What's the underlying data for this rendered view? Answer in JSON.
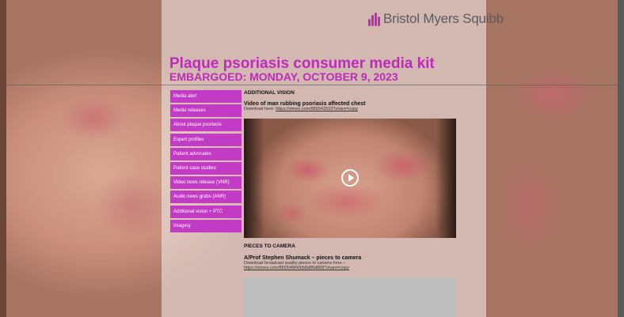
{
  "brand": {
    "name": "Bristol Myers Squibb",
    "accent_color": "#be2bbb",
    "logo_icon": "bms-brand-mark"
  },
  "header": {
    "title": "Plaque psoriasis consumer media kit",
    "subtitle": "EMBARGOED: MONDAY, OCTOBER 9, 2023"
  },
  "sidebar": {
    "items": [
      {
        "label": "Media alert"
      },
      {
        "label": "Media releases"
      },
      {
        "label": "About plaque psoriasis"
      },
      {
        "label": "Expert profiles"
      },
      {
        "label": "Patient advocates"
      },
      {
        "label": "Patient case studies"
      },
      {
        "label": "Video news release (VNR)"
      },
      {
        "label": "Audio news grabs (ANR)"
      },
      {
        "label": "Additional vision + PTC"
      },
      {
        "label": "Imagery"
      }
    ]
  },
  "main": {
    "additional_vision": {
      "heading": "ADDITIONAL VISION",
      "video_title": "Video of man rubbing psoriasis affected chest",
      "download_prefix": "Download here: ",
      "download_link": "https://vimeo.com/865542503?share=copy",
      "play_icon": "play-icon"
    },
    "pieces_to_camera": {
      "heading": "PIECES TO CAMERA",
      "video_title": "A/Prof Stephen Shumack – pieces to camera",
      "download_text": "Download broadcast quality pieces to camera here –",
      "download_link": "https://vimeo.com/865548643/b8d86d868?share=copy"
    }
  }
}
